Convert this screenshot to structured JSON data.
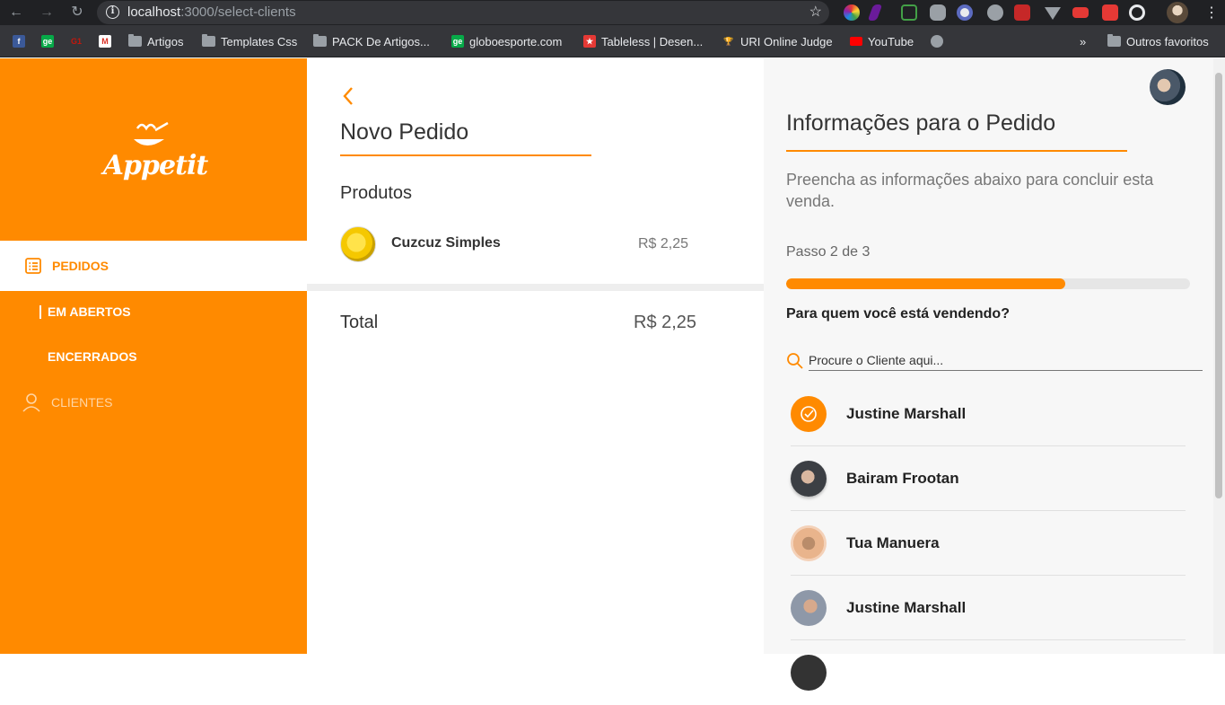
{
  "browser": {
    "url_host": "localhost",
    "url_path": ":3000/select-clients",
    "bookmarks": [
      {
        "label": ""
      },
      {
        "label": ""
      },
      {
        "label": ""
      },
      {
        "label": ""
      },
      {
        "label": "Artigos"
      },
      {
        "label": "Templates Css"
      },
      {
        "label": "PACK De Artigos..."
      },
      {
        "label": "globoesporte.com"
      },
      {
        "label": "Tableless | Desen..."
      },
      {
        "label": "URI Online Judge"
      },
      {
        "label": "YouTube"
      },
      {
        "label": ""
      }
    ],
    "overflow_label": "»",
    "other_bookmarks": "Outros favoritos"
  },
  "sidebar": {
    "logo_text": "Appetit",
    "items": [
      {
        "label": "PEDIDOS",
        "icon": "list-icon",
        "active": true
      },
      {
        "label": "EM ABERTOS",
        "sub": true,
        "active": true
      },
      {
        "label": "ENCERRADOS",
        "sub": true,
        "active": false
      },
      {
        "label": "CLIENTES",
        "icon": "user-icon",
        "active": false
      }
    ]
  },
  "order": {
    "title": "Novo Pedido",
    "products_label": "Produtos",
    "products": [
      {
        "name": "Cuzcuz Simples",
        "price": "R$ 2,25"
      }
    ],
    "total_label": "Total",
    "total_value": "R$ 2,25"
  },
  "info": {
    "title": "Informações para o Pedido",
    "description": "Preencha as informações abaixo para concluir esta venda.",
    "step": "Passo 2 de 3",
    "progress": 0.69,
    "question": "Para quem você está vendendo?",
    "search_placeholder": "Procure o Cliente aqui...",
    "clients": [
      {
        "name": "Justine Marshall",
        "selected": true
      },
      {
        "name": "Bairam Frootan",
        "selected": false
      },
      {
        "name": "Tua Manuera",
        "selected": false
      },
      {
        "name": "Justine Marshall",
        "selected": false
      }
    ]
  },
  "colors": {
    "accent": "#ff8a00",
    "chrome_dark": "#202124",
    "chrome_bar": "#35363a"
  }
}
